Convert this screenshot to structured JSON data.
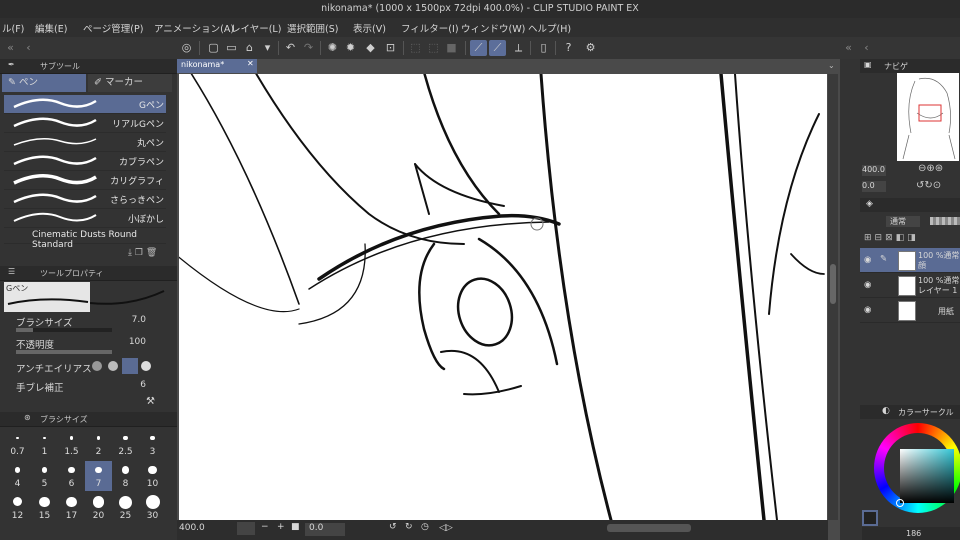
{
  "window": {
    "title": "nikonama* (1000 x 1500px 72dpi 400.0%) - CLIP STUDIO PAINT EX"
  },
  "menu": [
    "ル(F)",
    "編集(E)",
    "ページ管理(P)",
    "アニメーション(A)",
    "レイヤー(L)",
    "選択範囲(S)",
    "表示(V)",
    "フィルター(I)",
    "ウィンドウ(W)",
    "ヘルプ(H)"
  ],
  "left_panel": {
    "subtool_header": "サブツール",
    "tabs": [
      "ペン",
      "マーカー"
    ],
    "brushes": [
      "Gペン",
      "リアルGペン",
      "丸ペン",
      "カブラペン",
      "カリグラフィ",
      "さらっきペン",
      "小ぼかし",
      "Cinematic Dusts Round Standard"
    ],
    "tool_property_header": "ツールプロパティ",
    "current_brush": "Gペン",
    "properties": [
      {
        "name": "ブラシサイズ",
        "value": "7.0",
        "fill": 0.18
      },
      {
        "name": "不透明度",
        "value": "100",
        "fill": 1.0
      },
      {
        "name": "アンチエイリアス",
        "value": ""
      },
      {
        "name": "手ブレ補正",
        "value": "6"
      }
    ],
    "brush_size_header": "ブラシサイズ",
    "brush_sizes": [
      "0.7",
      "1",
      "1.5",
      "2",
      "2.5",
      "3",
      "4",
      "5",
      "6",
      "7",
      "8",
      "10",
      "12",
      "15",
      "17",
      "20",
      "25",
      "30"
    ],
    "selected_size": "7"
  },
  "document": {
    "tab": "nikonama*"
  },
  "statusbar": {
    "zoom": "400.0",
    "angle": "0.0"
  },
  "right_panel": {
    "navigator_header": "ナビゲ",
    "nav_zoom": "400.0",
    "nav_angle": "0.0",
    "blend_mode": "通常",
    "layers": [
      {
        "opacity": "100 %通常",
        "name": "顔",
        "selected": true
      },
      {
        "opacity": "100 %通常",
        "name": "レイヤー 1",
        "selected": false
      },
      {
        "opacity": "",
        "name": "用紙",
        "selected": false
      }
    ],
    "color_header": "カラーサークル",
    "color_readout": "186"
  },
  "colors": {
    "accent": "#5a6b94",
    "panel": "#333333",
    "canvas_bg": "#ffffff"
  }
}
